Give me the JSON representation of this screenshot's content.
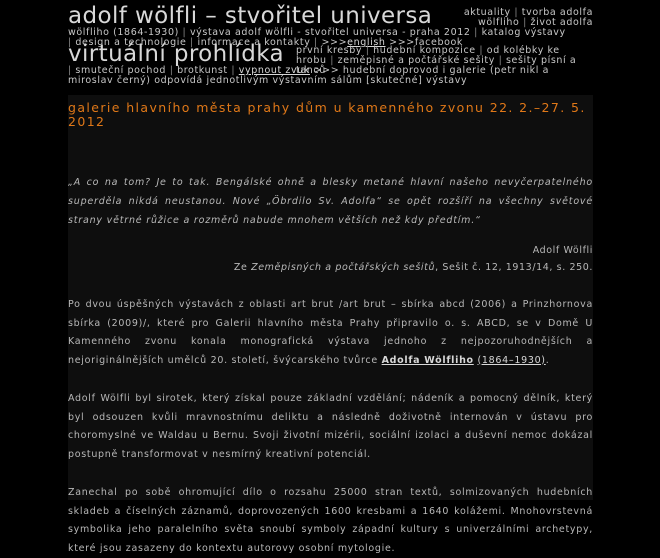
{
  "header": {
    "title": "adolf wölfli – stvořitel universa",
    "subtitle": "virtuální prohlídka",
    "nav_top": [
      "aktuality",
      "tvorba adolfa wölfliho",
      "život adolfa wölfliho (1864-1930)",
      "výstava adolf wölfli - stvořitel universa - praha 2012",
      "katalog výstavy",
      "design a technologie",
      "informace a kontakty"
    ],
    "lang_prefix": ">>>",
    "lang_link": "english",
    "facebook": ">>>facebook",
    "sub_nav": [
      "první kresby",
      "hudební kompozice",
      "od kolébky ke hrobu",
      "zeměpisné a počtářské sešity",
      "sešity písní a tanců",
      "smuteční pochod",
      "brotkunst"
    ],
    "sound_off": "vypnout zvuk",
    "sound_suffix": ">>> hudební doprovod i galerie (petr nikl a miroslav černý) odpovídá jednotlivým výstavním sálům [skutečné] výstavy"
  },
  "content": {
    "heading": "galerie hlavního města prahy dům u kamenného zvonu 22. 2.–27. 5. 2012",
    "quote": "„A co na tom? Je to tak. Bengálské ohně a blesky metané hlavní našeho nevyčerpatelného superděla nikdá neustanou. Nové „Öbrdilo Sv. Adolfa“ se opět rozšíří na všechny světové strany větrné růžice a rozměrů nabude mnohem větších než kdy předtím.“",
    "sig_author": "Adolf Wölfli",
    "sig_prefix": "Ze",
    "sig_source": "Zeměpisných a počtářských sešitů",
    "sig_suffix": ", Sešit č. 12, 1913/14, s. 250.",
    "p1_text": "Po dvou úspěšných výstavách z oblasti art brut /art brut – sbírka abcd (2006) a Prinzhornova sbírka (2009)/, které pro Galerii hlavního města Prahy připravilo o. s. ABCD, se v Domě U Kamenného zvonu konala monografická výstava jednoho z nejpozoruhodnějších a nejoriginálnějších umělců 20. století, švýcarského tvůrce ",
    "p1_link": "Adolfa Wölfliho",
    "p1_link_years": "(1864–1930)",
    "p1_end": ".",
    "p2": "Adolf Wölfli byl sirotek, který získal pouze základní vzdělání; nádeník a pomocný dělník, který byl odsouzen kvůli mravnostnímu deliktu a následně doživotně internován v ústavu pro choromyslné ve Waldau u Bernu. Svoji životní mizérii, sociální izolaci a duševní nemoc dokázal postupně transformovat v nesmírný kreativní potenciál.",
    "p3": "Zanechal po sobě ohromující dílo o rozsahu 25000 stran textů, solmizovaných hudebních skladeb a číselných záznamů, doprovozených 1600 kresbami a 1640 kolážemi. Mnohovrstevná symbolika jeho paralelního světa snoubí symboly západní kultury s univerzálními archetypy, které jsou zasazeny do kontextu autorovy osobní mytologie."
  }
}
